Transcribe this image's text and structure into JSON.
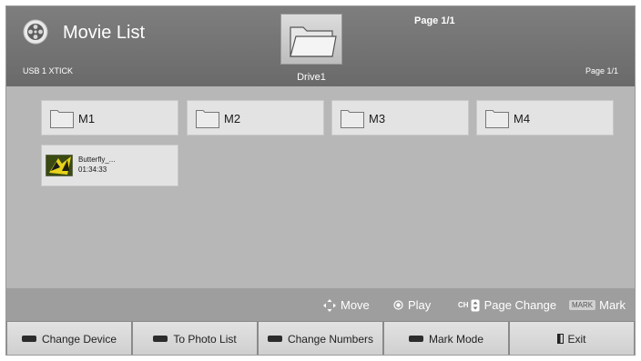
{
  "header": {
    "title": "Movie List",
    "device": "USB 1 XTICK",
    "drive": "Drive1",
    "page_top": "Page 1/1",
    "page_right": "Page 1/1"
  },
  "folders": [
    {
      "name": "M1"
    },
    {
      "name": "M2"
    },
    {
      "name": "M3"
    },
    {
      "name": "M4"
    }
  ],
  "video": {
    "name": "Butterfly_...",
    "duration": "01:34:33"
  },
  "hints": {
    "move": "Move",
    "play": "Play",
    "ch_label": "CH",
    "page_change": "Page Change",
    "mark_badge": "MARK",
    "mark": "Mark"
  },
  "buttons": [
    {
      "label": "Change Device",
      "key_color": "#2c2c2c"
    },
    {
      "label": "To Photo List",
      "key_color": "#2c2c2c"
    },
    {
      "label": "Change Numbers",
      "key_color": "#2c2c2c"
    },
    {
      "label": "Mark Mode",
      "key_color": "#2c2c2c"
    },
    {
      "label": "Exit",
      "icon": "exit-icon"
    }
  ]
}
